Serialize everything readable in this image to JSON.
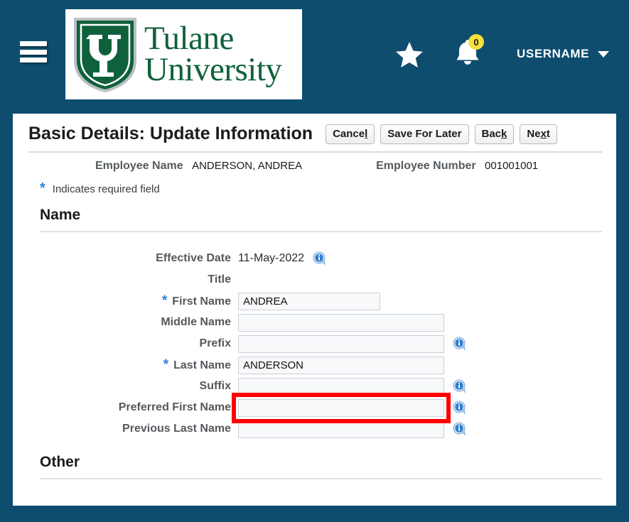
{
  "header": {
    "menu_icon": "hamburger-menu-icon",
    "logo": {
      "line1": "Tulane",
      "line2": "University",
      "monogram": "TU",
      "alt": "Tulane University"
    },
    "favorites_icon": "star-icon",
    "notifications_icon": "bell-icon",
    "notification_count": "0",
    "username": "USERNAME",
    "username_caret": "chevron-down-icon"
  },
  "page": {
    "title": "Basic Details: Update Information",
    "required_note": "Indicates required field",
    "required_marker": "*"
  },
  "toolbar": {
    "cancel": {
      "pre": "Cance",
      "key": "l",
      "post": ""
    },
    "save_for_later": {
      "pre": "Save For Later",
      "key": "",
      "post": ""
    },
    "back": {
      "pre": "Bac",
      "key": "k",
      "post": ""
    },
    "next": {
      "pre": "Ne",
      "key": "x",
      "post": "t"
    }
  },
  "employee": {
    "name_label": "Employee Name",
    "name_value": "ANDERSON, ANDREA",
    "number_label": "Employee Number",
    "number_value": "001001001"
  },
  "sections": {
    "name_heading": "Name",
    "other_heading": "Other"
  },
  "fields": {
    "effective_date": {
      "label": "Effective Date",
      "value": "11-May-2022",
      "info_icon": "info-icon"
    },
    "title": {
      "label": "Title",
      "value": ""
    },
    "first_name": {
      "label": "First Name",
      "value": "ANDREA",
      "required": "*",
      "placeholder": ""
    },
    "middle_name": {
      "label": "Middle Name",
      "value": "",
      "placeholder": ""
    },
    "prefix": {
      "label": "Prefix",
      "value": "",
      "placeholder": "",
      "info_icon": "info-icon"
    },
    "last_name": {
      "label": "Last Name",
      "value": "ANDERSON",
      "required": "*",
      "placeholder": ""
    },
    "suffix": {
      "label": "Suffix",
      "value": "",
      "placeholder": "",
      "info_icon": "info-icon"
    },
    "preferred_first_name": {
      "label": "Preferred First Name",
      "value": "",
      "placeholder": "",
      "info_icon": "info-icon",
      "highlighted": true
    },
    "previous_last_name": {
      "label": "Previous Last Name",
      "value": "",
      "placeholder": "",
      "info_icon": "info-icon"
    }
  },
  "colors": {
    "brand_teal": "#0e4d6e",
    "brand_green": "#0f613b",
    "accent_blue": "#2f7fd0",
    "highlight_red": "#ff0000",
    "badge_yellow": "#f5e03c"
  }
}
